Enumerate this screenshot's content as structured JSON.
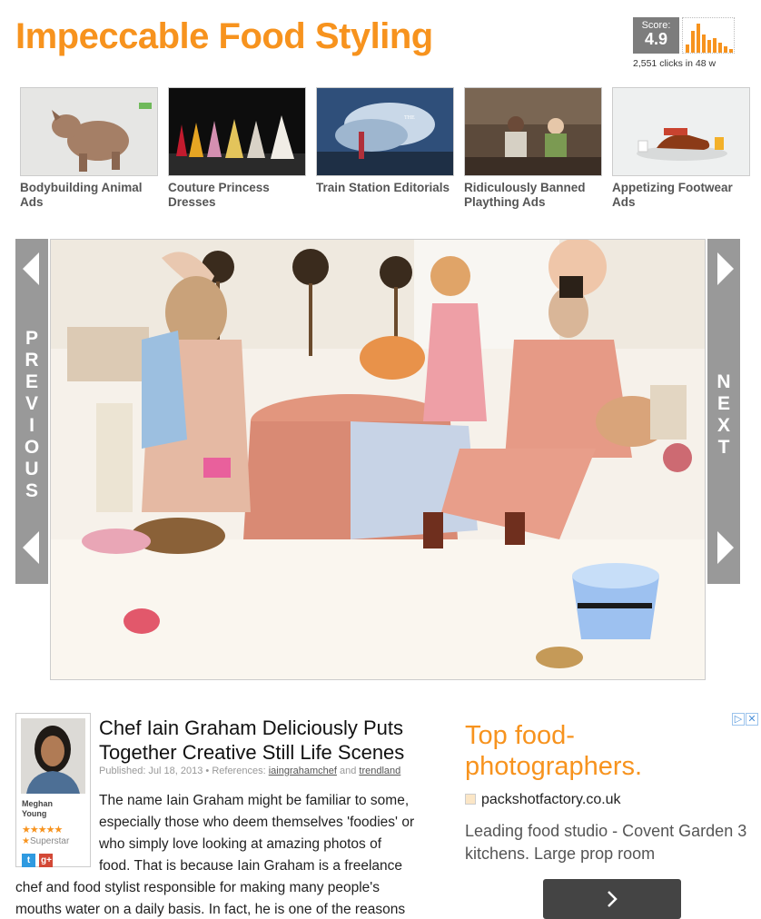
{
  "page": {
    "title": "Impeccable Food Styling"
  },
  "score": {
    "label": "Score:",
    "value": "4.9",
    "clicks": "2,551 clicks in 48 w",
    "accent": "#f7931e"
  },
  "related": [
    {
      "label": "Bodybuilding Animal Ads"
    },
    {
      "label": "Couture Princess Dresses"
    },
    {
      "label": "Train Station Editorials"
    },
    {
      "label": "Ridiculously Banned Plaything Ads"
    },
    {
      "label": "Appetizing Footwear Ads"
    }
  ],
  "gallery": {
    "prev_letters": [
      "P",
      "R",
      "E",
      "V",
      "I",
      "O",
      "U",
      "S"
    ],
    "next_letters": [
      "N",
      "E",
      "X",
      "T"
    ]
  },
  "author": {
    "name_line1": "Meghan",
    "name_line2": "Young",
    "stars": "★★★★★",
    "rank_star": "★",
    "rank": "Superstar",
    "twitter": "t",
    "gplus": "g+"
  },
  "article": {
    "title": "Chef Iain Graham Deliciously Puts Together Creative Still Life Scenes",
    "meta_published": "Published: Jul 18, 2013 • References:",
    "ref1": "iaingrahamchef",
    "meta_and": "and",
    "ref2": "trendland",
    "body_line1": "The name Iain Graham might be familiar to some,",
    "body_line2": "especially those who deem themselves 'foodies' or",
    "body_line3": "who simply love looking at amazing photos of",
    "body_line4": "food. That is because Iain Graham is a freelance",
    "body_line5": "chef and food stylist responsible for making many people's",
    "body_line6": "mouths water on a daily basis. In fact, he is one of the reasons"
  },
  "ad": {
    "choices": "▷ ✕",
    "headline": "Top food-photographers.",
    "url": "packshotfactory.co.uk",
    "description": "Leading food studio - Covent Garden 3 kitchens. Large prop room"
  }
}
